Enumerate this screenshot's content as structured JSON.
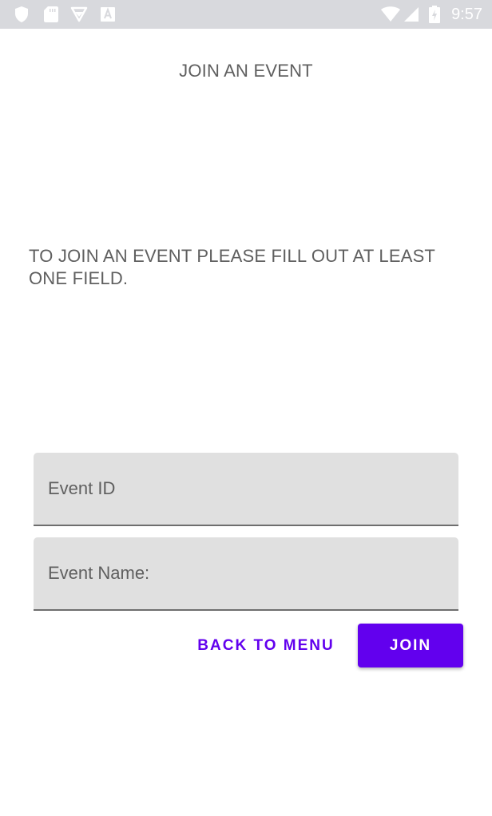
{
  "status_bar": {
    "time": "9:57",
    "icons": [
      "shield-icon",
      "sd-card-icon",
      "play-store-icon",
      "font-icon",
      "wifi-icon",
      "signal-icon",
      "battery-icon"
    ],
    "text_color": "#ffffff",
    "background": "#d8d9dd"
  },
  "page": {
    "title": "JOIN AN EVENT",
    "instructions": "TO JOIN AN EVENT PLEASE FILL OUT AT LEAST ONE FIELD."
  },
  "form": {
    "event_id": {
      "placeholder": "Event ID",
      "value": ""
    },
    "event_name": {
      "placeholder": "Event Name:",
      "value": ""
    }
  },
  "actions": {
    "back_label": "BACK TO MENU",
    "join_label": "JOIN"
  },
  "colors": {
    "accent": "#6200ee",
    "field_background": "#e0e0e0",
    "text": "#5f5f5f"
  }
}
